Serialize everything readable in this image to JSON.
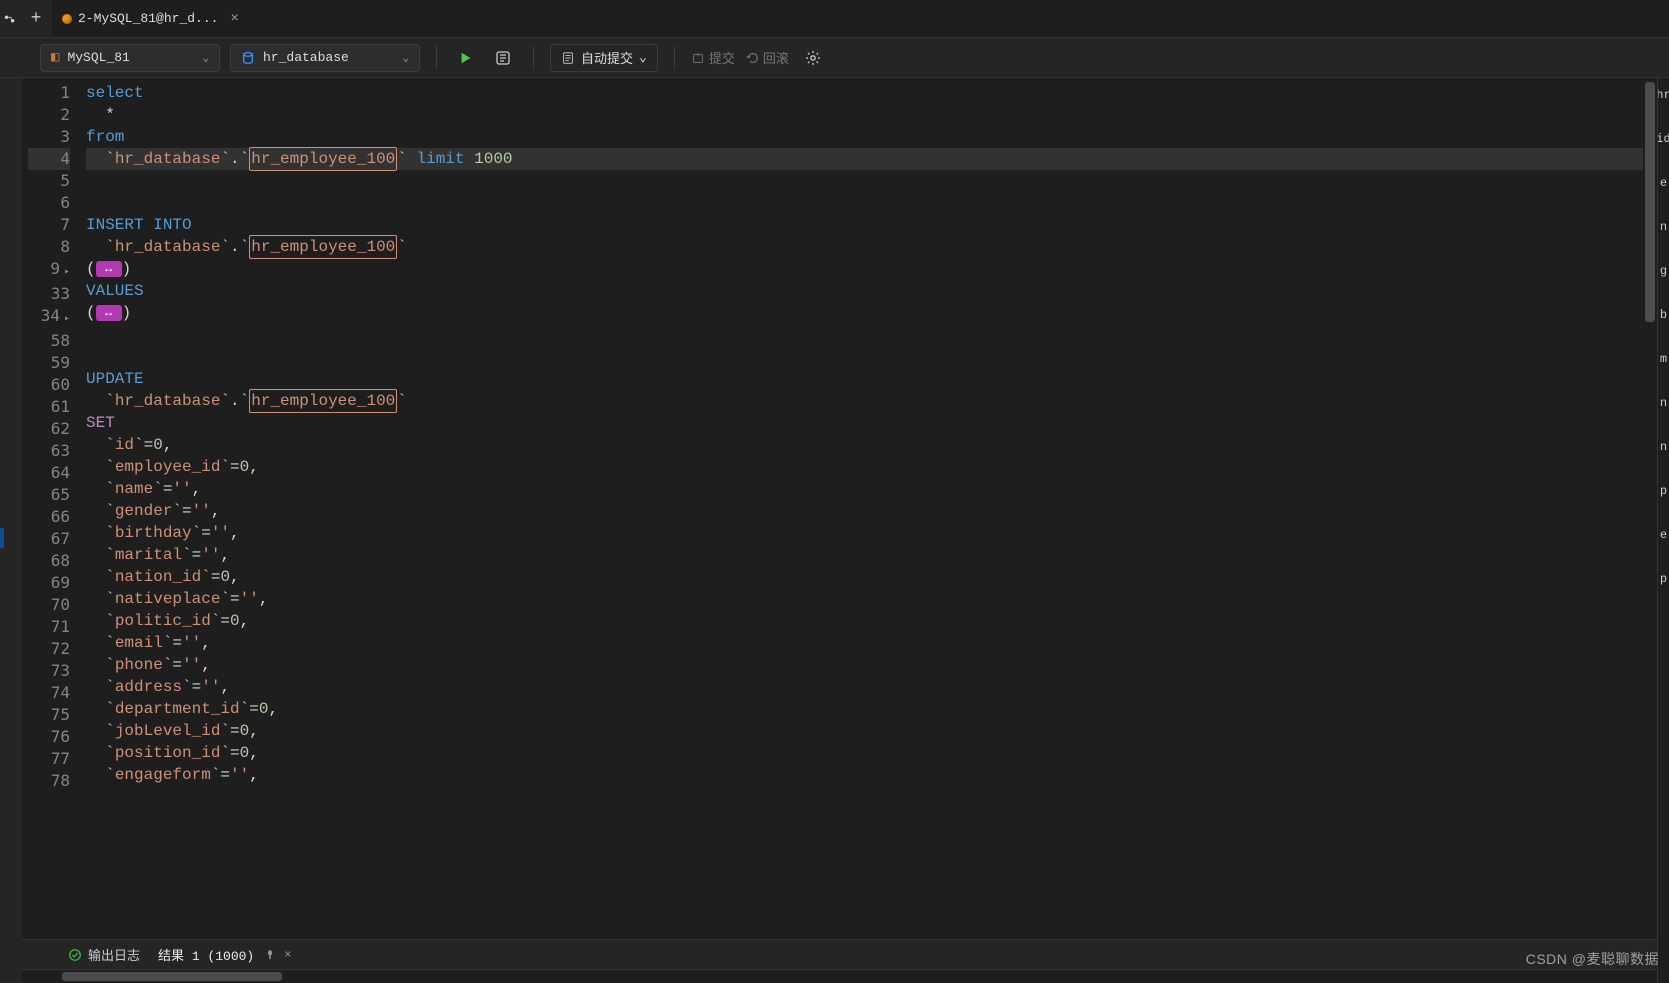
{
  "tab": {
    "label": "2-MySQL_81@hr_d..."
  },
  "toolbar": {
    "connection": "MySQL_81",
    "database": "hr_database",
    "autocommit": "自动提交",
    "commit": "提交",
    "rollback": "回滚"
  },
  "editor": {
    "lines": [
      {
        "n": "1",
        "t": [
          [
            "kw-blue",
            "select"
          ]
        ]
      },
      {
        "n": "2",
        "t": [
          [
            "punct",
            "  *"
          ]
        ]
      },
      {
        "n": "3",
        "t": [
          [
            "kw-blue",
            "from"
          ]
        ]
      },
      {
        "n": "4",
        "t": [
          [
            "punct",
            "  `"
          ],
          [
            "ident",
            "hr_database"
          ],
          [
            "punct",
            "`.`"
          ],
          [
            "boxed",
            "hr_employee_100"
          ],
          [
            "punct",
            "` "
          ],
          [
            "kw-blue",
            "limit"
          ],
          [
            "punct",
            " "
          ],
          [
            "num",
            "1000"
          ]
        ],
        "hl": true
      },
      {
        "n": "5",
        "t": []
      },
      {
        "n": "6",
        "t": []
      },
      {
        "n": "7",
        "t": [
          [
            "kw-blue",
            "INSERT INTO"
          ]
        ]
      },
      {
        "n": "8",
        "t": [
          [
            "punct",
            "  `"
          ],
          [
            "ident",
            "hr_database"
          ],
          [
            "punct",
            "`.`"
          ],
          [
            "boxed",
            "hr_employee_100"
          ],
          [
            "punct",
            "`"
          ]
        ]
      },
      {
        "n": "9",
        "t": [
          [
            "punct",
            "("
          ],
          [
            "fold",
            "↔"
          ],
          [
            "punct",
            ")"
          ]
        ],
        "fold": true
      },
      {
        "n": "33",
        "t": [
          [
            "kw-blue",
            "VALUES"
          ]
        ]
      },
      {
        "n": "34",
        "t": [
          [
            "punct",
            "("
          ],
          [
            "fold",
            "↔"
          ],
          [
            "punct",
            ")"
          ]
        ],
        "fold": true
      },
      {
        "n": "58",
        "t": []
      },
      {
        "n": "59",
        "t": []
      },
      {
        "n": "60",
        "t": [
          [
            "kw-blue",
            "UPDATE"
          ]
        ]
      },
      {
        "n": "61",
        "t": [
          [
            "punct",
            "  `"
          ],
          [
            "ident",
            "hr_database"
          ],
          [
            "punct",
            "`.`"
          ],
          [
            "boxed",
            "hr_employee_100"
          ],
          [
            "punct",
            "`"
          ]
        ]
      },
      {
        "n": "62",
        "t": [
          [
            "kw-purple",
            "SET"
          ]
        ]
      },
      {
        "n": "63",
        "t": [
          [
            "punct",
            "  `"
          ],
          [
            "ident",
            "id"
          ],
          [
            "punct",
            "`="
          ],
          [
            "num",
            "0"
          ],
          [
            "punct",
            ","
          ]
        ]
      },
      {
        "n": "64",
        "t": [
          [
            "punct",
            "  `"
          ],
          [
            "ident",
            "employee_id"
          ],
          [
            "punct",
            "`="
          ],
          [
            "num",
            "0"
          ],
          [
            "punct",
            ","
          ]
        ]
      },
      {
        "n": "65",
        "t": [
          [
            "punct",
            "  `"
          ],
          [
            "ident",
            "name"
          ],
          [
            "punct",
            "`="
          ],
          [
            "str",
            "''"
          ],
          [
            "punct",
            ","
          ]
        ]
      },
      {
        "n": "66",
        "t": [
          [
            "punct",
            "  `"
          ],
          [
            "ident",
            "gender"
          ],
          [
            "punct",
            "`="
          ],
          [
            "str",
            "''"
          ],
          [
            "punct",
            ","
          ]
        ]
      },
      {
        "n": "67",
        "t": [
          [
            "punct",
            "  `"
          ],
          [
            "ident",
            "birthday"
          ],
          [
            "punct",
            "`="
          ],
          [
            "str",
            "''"
          ],
          [
            "punct",
            ","
          ]
        ]
      },
      {
        "n": "68",
        "t": [
          [
            "punct",
            "  `"
          ],
          [
            "ident",
            "marital"
          ],
          [
            "punct",
            "`="
          ],
          [
            "str",
            "''"
          ],
          [
            "punct",
            ","
          ]
        ]
      },
      {
        "n": "69",
        "t": [
          [
            "punct",
            "  `"
          ],
          [
            "ident",
            "nation_id"
          ],
          [
            "punct",
            "`="
          ],
          [
            "num",
            "0"
          ],
          [
            "punct",
            ","
          ]
        ]
      },
      {
        "n": "70",
        "t": [
          [
            "punct",
            "  `"
          ],
          [
            "ident",
            "nativeplace"
          ],
          [
            "punct",
            "`="
          ],
          [
            "str",
            "''"
          ],
          [
            "punct",
            ","
          ]
        ]
      },
      {
        "n": "71",
        "t": [
          [
            "punct",
            "  `"
          ],
          [
            "ident",
            "politic_id"
          ],
          [
            "punct",
            "`="
          ],
          [
            "num",
            "0"
          ],
          [
            "punct",
            ","
          ]
        ]
      },
      {
        "n": "72",
        "t": [
          [
            "punct",
            "  `"
          ],
          [
            "ident",
            "email"
          ],
          [
            "punct",
            "`="
          ],
          [
            "str",
            "''"
          ],
          [
            "punct",
            ","
          ]
        ]
      },
      {
        "n": "73",
        "t": [
          [
            "punct",
            "  `"
          ],
          [
            "ident",
            "phone"
          ],
          [
            "punct",
            "`="
          ],
          [
            "str",
            "''"
          ],
          [
            "punct",
            ","
          ]
        ]
      },
      {
        "n": "74",
        "t": [
          [
            "punct",
            "  `"
          ],
          [
            "ident",
            "address"
          ],
          [
            "punct",
            "`="
          ],
          [
            "str",
            "''"
          ],
          [
            "punct",
            ","
          ]
        ]
      },
      {
        "n": "75",
        "t": [
          [
            "punct",
            "  `"
          ],
          [
            "ident",
            "department_id"
          ],
          [
            "punct",
            "`="
          ],
          [
            "num",
            "0"
          ],
          [
            "punct",
            ","
          ]
        ]
      },
      {
        "n": "76",
        "t": [
          [
            "punct",
            "  `"
          ],
          [
            "ident",
            "jobLevel_id"
          ],
          [
            "punct",
            "`="
          ],
          [
            "num",
            "0"
          ],
          [
            "punct",
            ","
          ]
        ]
      },
      {
        "n": "77",
        "t": [
          [
            "punct",
            "  `"
          ],
          [
            "ident",
            "position_id"
          ],
          [
            "punct",
            "`="
          ],
          [
            "num",
            "0"
          ],
          [
            "punct",
            ","
          ]
        ]
      },
      {
        "n": "78",
        "t": [
          [
            "punct",
            "  `"
          ],
          [
            "ident",
            "engageform"
          ],
          [
            "punct",
            "`="
          ],
          [
            "str",
            "''"
          ],
          [
            "punct",
            ","
          ]
        ]
      }
    ]
  },
  "right_rail": [
    "hr",
    "id",
    "e",
    "n",
    "g",
    "b",
    "m",
    "n",
    "n",
    "p",
    "e",
    "p"
  ],
  "bottom": {
    "log": "输出日志",
    "result": "结果 1 (1000)"
  },
  "watermark": "CSDN @麦聪聊数据"
}
